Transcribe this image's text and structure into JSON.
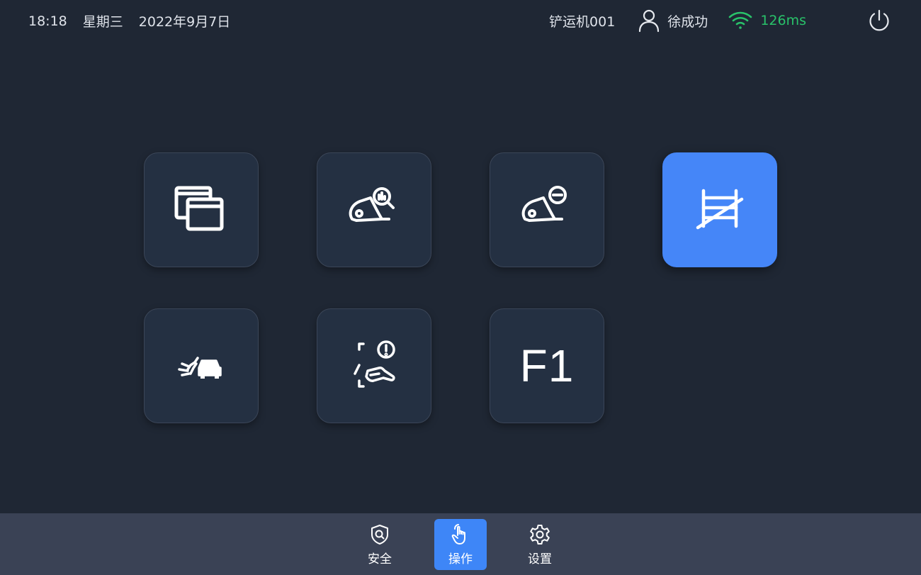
{
  "status": {
    "time": "18:18",
    "weekday": "星期三",
    "date": "2022年9月7日",
    "machine": "铲运机001",
    "user": "徐成功",
    "latency": "126ms"
  },
  "icons": {
    "user": "user-icon",
    "wifi": "wifi-icon",
    "power": "power-icon"
  },
  "tiles": [
    {
      "id": "windows",
      "icon": "windows-icon",
      "active": false
    },
    {
      "id": "loader-inspect",
      "icon": "loader-inspect-icon",
      "active": false
    },
    {
      "id": "loader-remove",
      "icon": "loader-remove-icon",
      "active": false
    },
    {
      "id": "barrier-off",
      "icon": "barrier-off-icon",
      "active": true
    },
    {
      "id": "vehicle-sensor",
      "icon": "vehicle-sensor-icon",
      "active": false
    },
    {
      "id": "hand-alert",
      "icon": "hand-alert-icon",
      "active": false
    },
    {
      "id": "f1",
      "label": "F1",
      "active": false
    }
  ],
  "nav": {
    "items": [
      {
        "label": "安全",
        "icon": "shield-search-icon",
        "active": false
      },
      {
        "label": "操作",
        "icon": "hand-pointer-icon",
        "active": true
      },
      {
        "label": "设置",
        "icon": "gear-icon",
        "active": false
      }
    ]
  },
  "colors": {
    "background": "#1f2734",
    "tile": "#243042",
    "accent": "#4586f8",
    "bottom_bar": "#3a4255",
    "latency_ok": "#29c26a"
  }
}
